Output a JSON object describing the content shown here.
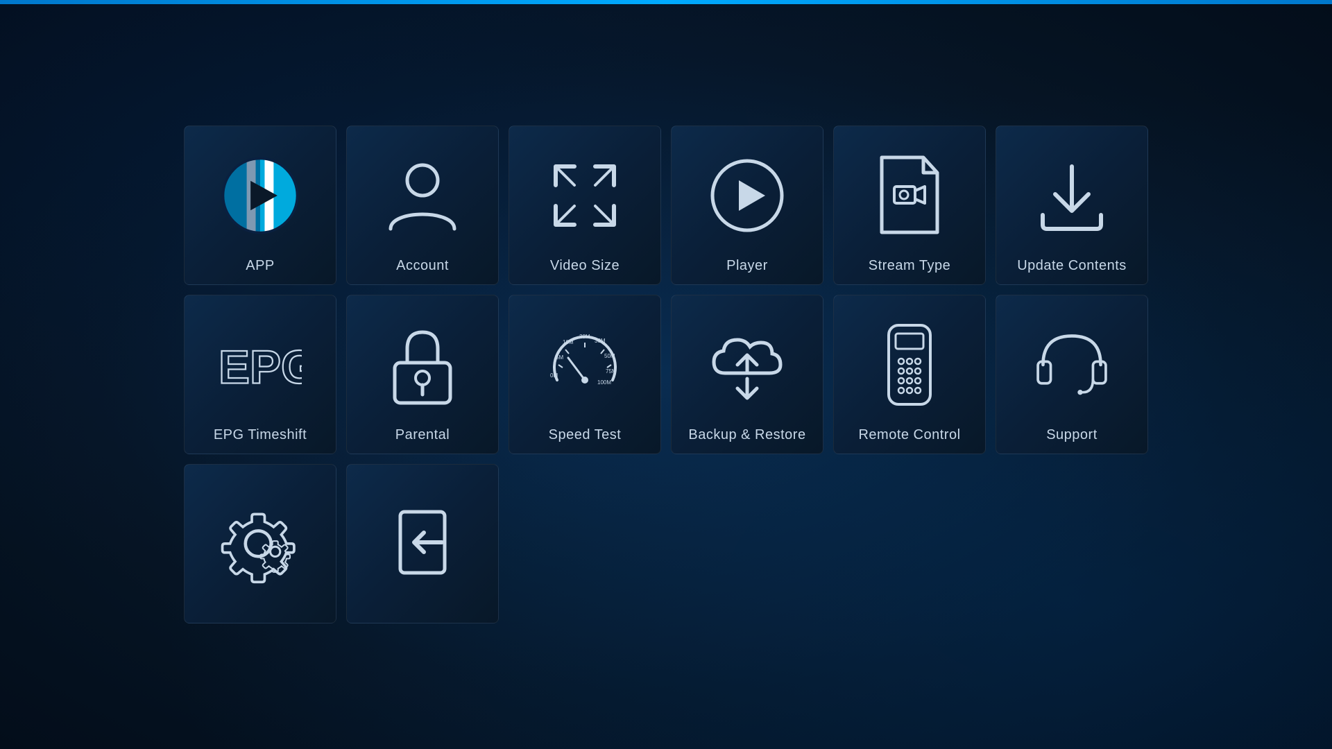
{
  "tiles": [
    {
      "id": "app",
      "label": "APP",
      "icon": "app"
    },
    {
      "id": "account",
      "label": "Account",
      "icon": "account"
    },
    {
      "id": "video-size",
      "label": "Video Size",
      "icon": "video-size"
    },
    {
      "id": "player",
      "label": "Player",
      "icon": "player"
    },
    {
      "id": "stream-type",
      "label": "Stream Type",
      "icon": "stream-type"
    },
    {
      "id": "update-contents",
      "label": "Update Contents",
      "icon": "update-contents"
    },
    {
      "id": "epg",
      "label": "EPG Timeshift",
      "icon": "epg"
    },
    {
      "id": "parental",
      "label": "Parental",
      "icon": "parental"
    },
    {
      "id": "speed-test",
      "label": "Speed Test",
      "icon": "speed-test"
    },
    {
      "id": "backup-restore",
      "label": "Backup & Restore",
      "icon": "backup-restore"
    },
    {
      "id": "remote-control",
      "label": "Remote Control",
      "icon": "remote-control"
    },
    {
      "id": "support",
      "label": "Support",
      "icon": "support"
    },
    {
      "id": "settings",
      "label": "",
      "icon": "settings"
    },
    {
      "id": "logout",
      "label": "",
      "icon": "logout"
    }
  ]
}
